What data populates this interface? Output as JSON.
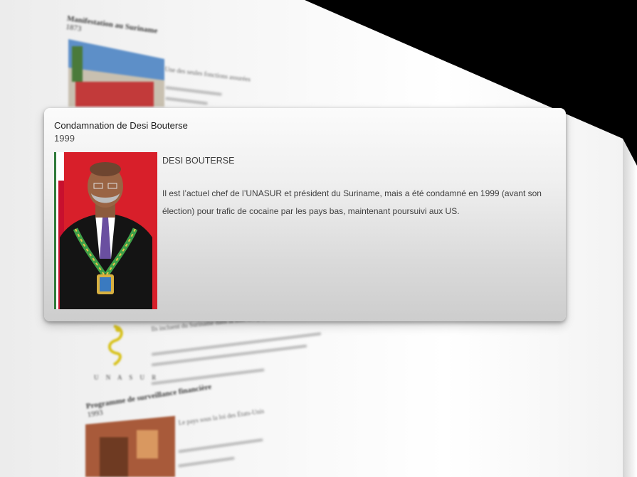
{
  "featured_event": {
    "title": "Condamnation de Desi Bouterse",
    "year": "1999",
    "photo_icon": "portrait-photo",
    "heading": "DESI BOUTERSE",
    "description": "Il est l’actuel chef de l’UNASUR et président du Suriname, mais a été condamné en 1999 (avant son élection) pour trafic de cocaine par les pays bas, maintenant poursuivi aux US."
  },
  "background_events": {
    "top": {
      "title": "Manifestation au Suriname",
      "year": "1873",
      "lines": [
        "Une des seules fonctions assurées"
      ]
    },
    "middle": {
      "logo_text": "U N A S U R",
      "lines": [
        "Ils incluent du Suriname dans la liste des pays"
      ]
    },
    "bottom": {
      "title": "Programme de surveillance financière",
      "year": "1993",
      "lines": [
        "Le pays sous la loi des États-Unis"
      ]
    }
  },
  "colors": {
    "card_top": "#fbfbfb",
    "card_bottom": "#cdcdcd",
    "wedge": "#000000",
    "portrait_background": "#d81f2a"
  }
}
